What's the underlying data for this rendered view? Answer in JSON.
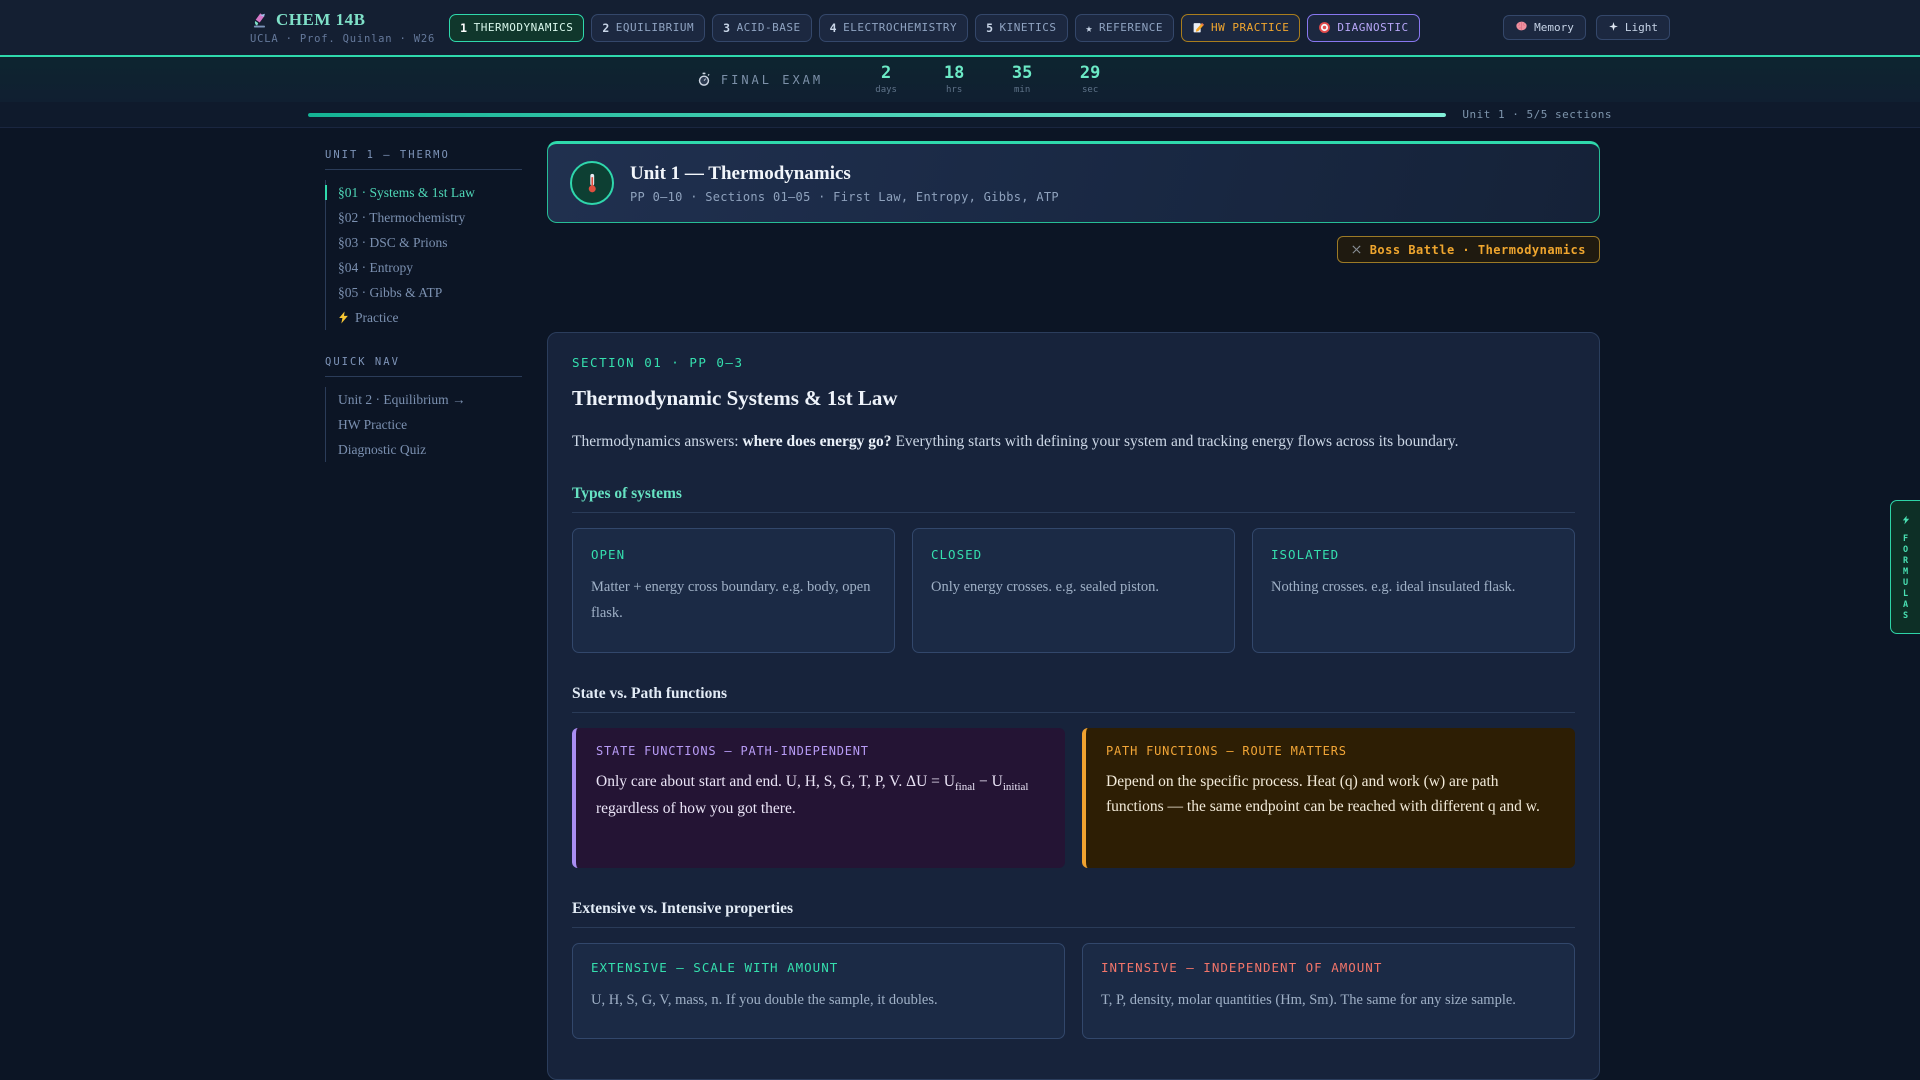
{
  "header": {
    "logo_icon": "microscope",
    "title": "CHEM 14B",
    "subtitle": "UCLA · Prof. Quinlan · W26",
    "tabs": [
      {
        "num": "1",
        "label": "THERMODYNAMICS",
        "active": true
      },
      {
        "num": "2",
        "label": "EQUILIBRIUM"
      },
      {
        "num": "3",
        "label": "ACID-BASE"
      },
      {
        "num": "4",
        "label": "ELECTROCHEMISTRY"
      },
      {
        "num": "5",
        "label": "KINETICS"
      },
      {
        "num": "★",
        "label": "REFERENCE"
      },
      {
        "icon": "pencil",
        "label": "HW PRACTICE"
      },
      {
        "icon": "target",
        "label": "DIAGNOSTIC"
      }
    ],
    "memory_button": {
      "icon": "brain",
      "label": "Memory"
    },
    "light_button": {
      "icon": "sparkle",
      "label": "Light"
    }
  },
  "countdown": {
    "icon": "stopwatch",
    "label": "FINAL EXAM",
    "units": [
      {
        "value": "2",
        "unit": "days"
      },
      {
        "value": "18",
        "unit": "hrs"
      },
      {
        "value": "35",
        "unit": "min"
      },
      {
        "value": "29",
        "unit": "sec"
      }
    ]
  },
  "progress": {
    "label": "Unit 1 · 5/5 sections",
    "percent": 100
  },
  "sidebar": {
    "unit_nav_title": "UNIT 1 — THERMO",
    "unit_items": [
      {
        "label": "§01 · Systems & 1st Law",
        "active": true
      },
      {
        "label": "§02 · Thermochemistry"
      },
      {
        "label": "§03 · DSC & Prions"
      },
      {
        "label": "§04 · Entropy"
      },
      {
        "label": "§05 · Gibbs & ATP"
      },
      {
        "label": "Practice",
        "icon": "lightning"
      }
    ],
    "quick_nav_title": "QUICK NAV",
    "quick_items": [
      "Unit 2 · Equilibrium →",
      "HW Practice",
      "Diagnostic Quiz"
    ]
  },
  "unit_header": {
    "icon": "thermometer",
    "title": "Unit 1 — Thermodynamics",
    "subtitle": "PP 0–10 · Sections 01–05 · First Law, Entropy, Gibbs, ATP"
  },
  "boss_battle": {
    "icon": "crossed-swords",
    "label": "Boss Battle · Thermodynamics"
  },
  "section": {
    "kicker": "SECTION 01 · PP 0–3",
    "title": "Thermodynamic Systems & 1st Law",
    "intro": {
      "p1": "Thermodynamics answers: ",
      "bold": "where does energy go?",
      "p2": " Everything starts with defining your system and tracking energy flows across its boundary."
    },
    "types_heading": "Types of systems",
    "system_cards": [
      {
        "label": "OPEN",
        "body": "Matter + energy cross boundary. e.g. body, open flask."
      },
      {
        "label": "CLOSED",
        "body": "Only energy crosses. e.g. sealed piston."
      },
      {
        "label": "ISOLATED",
        "body": "Nothing crosses. e.g. ideal insulated flask."
      }
    ],
    "state_path_heading": "State vs. Path functions",
    "state_callout": {
      "label": "STATE FUNCTIONS — PATH-INDEPENDENT",
      "p1": "Only care about start and end. U, H, S, G, T, P, V. ΔU = U",
      "sub1": "final",
      "p2": " − U",
      "sub2": "initial",
      "p3": " regardless of how you got there."
    },
    "path_callout": {
      "label": "PATH FUNCTIONS — ROUTE MATTERS",
      "body": "Depend on the specific process. Heat (q) and work (w) are path functions — the same endpoint can be reached with different q and w."
    },
    "ext_int_heading": "Extensive vs. Intensive properties",
    "extensive_card": {
      "label": "EXTENSIVE — SCALE WITH AMOUNT",
      "body": "U, H, S, G, V, mass, n. If you double the sample, it doubles."
    },
    "intensive_card": {
      "label": "INTENSIVE — INDEPENDENT OF AMOUNT",
      "body": "T, P, density, molar quantities (Hm, Sm). The same for any size sample."
    }
  },
  "formulas_tab": {
    "icon": "lightning",
    "label": "FORMULAS"
  },
  "colors": {
    "accent_teal": "#2fd9ac",
    "accent_orange": "#f0a62e",
    "accent_purple": "#a98ef2",
    "accent_red": "#f2756a",
    "background": "#0c1525"
  }
}
